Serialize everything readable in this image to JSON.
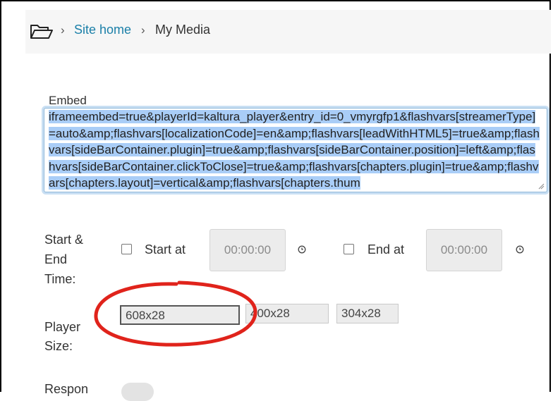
{
  "breadcrumb": {
    "separator": "›",
    "site_home": "Site home",
    "current": "My Media"
  },
  "embed": {
    "label": "Embed",
    "code": "iframeembed=true&playerId=kaltura_player&entry_id=0_vmyrgfp1&flashvars[streamerType]=auto&amp;flashvars[localizationCode]=en&amp;flashvars[leadWithHTML5]=true&amp;flashvars[sideBarContainer.plugin]=true&amp;flashvars[sideBarContainer.position]=left&amp;flashvars[sideBarContainer.clickToClose]=true&amp;flashvars[chapters.plugin]=true&amp;flashvars[chapters.layout]=vertical&amp;flashvars[chapters.thum"
  },
  "time": {
    "label_line1": "Start &",
    "label_line2": "End",
    "label_line3": "Time:",
    "start_label": "Start at",
    "start_value": "00:00:00",
    "end_label": "End at",
    "end_value": "00:00:00"
  },
  "player_size": {
    "label_line1": "Player",
    "label_line2": "Size:",
    "options": [
      "608x28",
      "400x28",
      "304x28"
    ]
  },
  "responsive": {
    "label": "Respon"
  },
  "colors": {
    "link": "#1a7fa8",
    "selection": "#a9cdf7",
    "annotation": "#e0231b"
  },
  "icons": {
    "folder": "folder-outline-icon",
    "clock": "clock-icon"
  }
}
